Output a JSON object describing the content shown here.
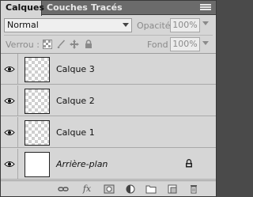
{
  "tabs": [
    {
      "label": "Calques",
      "active": true
    },
    {
      "label": "Couches",
      "active": false
    },
    {
      "label": "Tracés",
      "active": false
    }
  ],
  "blend": {
    "value": "Normal"
  },
  "opacity": {
    "label": "Opacité :",
    "value": "100%"
  },
  "lock": {
    "label": "Verrou :"
  },
  "fill": {
    "label": "Fond :",
    "value": "100%"
  },
  "layers": [
    {
      "name": "Calque 3",
      "visible": true,
      "transparent": true
    },
    {
      "name": "Calque 2",
      "visible": true,
      "transparent": true
    },
    {
      "name": "Calque 1",
      "visible": true,
      "transparent": true
    },
    {
      "name": "Arrière-plan",
      "visible": true,
      "transparent": false,
      "locked": true,
      "italic": true
    }
  ],
  "toolbar": {
    "icons": [
      "link-layers-icon",
      "fx-icon",
      "add-mask-icon",
      "adjustment-layer-icon",
      "new-group-icon",
      "new-layer-icon",
      "delete-layer-icon"
    ],
    "fx_label": "fx"
  },
  "colors": {
    "panel": "#d6d6d6",
    "tabbar": "#6b6b6b",
    "border": "#3a3a3a"
  }
}
